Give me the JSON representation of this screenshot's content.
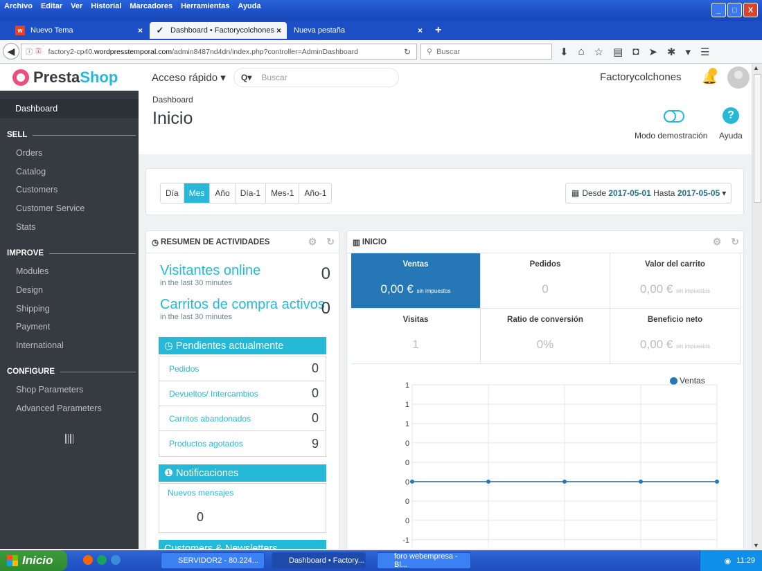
{
  "browser": {
    "menu": [
      "Archivo",
      "Editar",
      "Ver",
      "Historial",
      "Marcadores",
      "Herramientas",
      "Ayuda"
    ],
    "tabs": [
      {
        "label": "Nuevo Tema"
      },
      {
        "label": "Dashboard • Factorycolchones"
      },
      {
        "label": "Nueva pestaña"
      }
    ],
    "url_prefix": "factory2-cp40.",
    "url_host": "wordpresstemporal.com",
    "url_path": "/admin8487nd4dn/index.php?controller=AdminDashboard",
    "search_placeholder": "Buscar",
    "window_buttons": [
      "_",
      "□",
      "X"
    ]
  },
  "header": {
    "logo_part1": "Presta",
    "logo_part2": "Shop",
    "quick_access": "Acceso rápido ▾",
    "search_prefix": "Q▾",
    "search_placeholder": "Buscar",
    "shop_name": "Factorycolchones"
  },
  "sidebar": {
    "dashboard": "Dashboard",
    "sections": [
      {
        "title": "SELL",
        "items": [
          "Orders",
          "Catalog",
          "Customers",
          "Customer Service",
          "Stats"
        ]
      },
      {
        "title": "IMPROVE",
        "items": [
          "Modules",
          "Design",
          "Shipping",
          "Payment",
          "International"
        ]
      },
      {
        "title": "CONFIGURE",
        "items": [
          "Shop Parameters",
          "Advanced Parameters"
        ]
      }
    ]
  },
  "page": {
    "breadcrumb": "Dashboard",
    "title": "Inicio",
    "demo_label": "Modo demostración",
    "help_label": "Ayuda"
  },
  "filters": {
    "periods": [
      "Día",
      "Mes",
      "Año",
      "Día-1",
      "Mes-1",
      "Año-1"
    ],
    "active_period": "Mes",
    "date_from_label": "Desde",
    "date_from": "2017-05-01",
    "date_to_label": "Hasta",
    "date_to": "2017-05-05"
  },
  "activity": {
    "title": "RESUMEN DE ACTIVIDADES",
    "online_label": "Visitantes online",
    "online_sub": "in the last 30 minutes",
    "online_value": "0",
    "carts_label": "Carritos de compra activos",
    "carts_sub": "in the last 30 minutes",
    "carts_value": "0",
    "pending_title": "Pendientes actualmente",
    "pending": [
      {
        "label": "Pedidos",
        "value": "0"
      },
      {
        "label": "Devueltos/ Intercambios",
        "value": "0"
      },
      {
        "label": "Carritos abandonados",
        "value": "0"
      },
      {
        "label": "Productos agotados",
        "value": "9"
      }
    ],
    "notif_title": "Notificaciones",
    "notif_messages": "Nuevos mensajes",
    "notif_value": "0",
    "customers_title": "Customers & Newsletters"
  },
  "dashboard": {
    "title": "INICIO",
    "kpis": [
      {
        "label": "Ventas",
        "value": "0,00 €",
        "suffix": "sin impuestos"
      },
      {
        "label": "Pedidos",
        "value": "0",
        "suffix": ""
      },
      {
        "label": "Valor del carrito",
        "value": "0,00 €",
        "suffix": "sin impuestos"
      },
      {
        "label": "Visitas",
        "value": "1",
        "suffix": ""
      },
      {
        "label": "Ratio de conversión",
        "value": "0%",
        "suffix": ""
      },
      {
        "label": "Beneficio neto",
        "value": "0,00 €",
        "suffix": "sin impuestos"
      }
    ]
  },
  "chart_data": {
    "type": "line",
    "series": [
      {
        "name": "Ventas",
        "values": [
          0,
          0,
          0,
          0,
          0
        ]
      }
    ],
    "y_tick_labels": [
      "1",
      "1",
      "1",
      "0",
      "0",
      "0",
      "0",
      "0",
      "-1"
    ],
    "ylim": [
      -1,
      1
    ],
    "grid": true,
    "legend": "top-right",
    "color": "#2578b5"
  },
  "taskbar": {
    "start": "Inicio",
    "tasks": [
      "SERVIDOR2 - 80.224...",
      "Dashboard • Factory...",
      "foro webempresa - Bl..."
    ],
    "clock": "11:29"
  }
}
